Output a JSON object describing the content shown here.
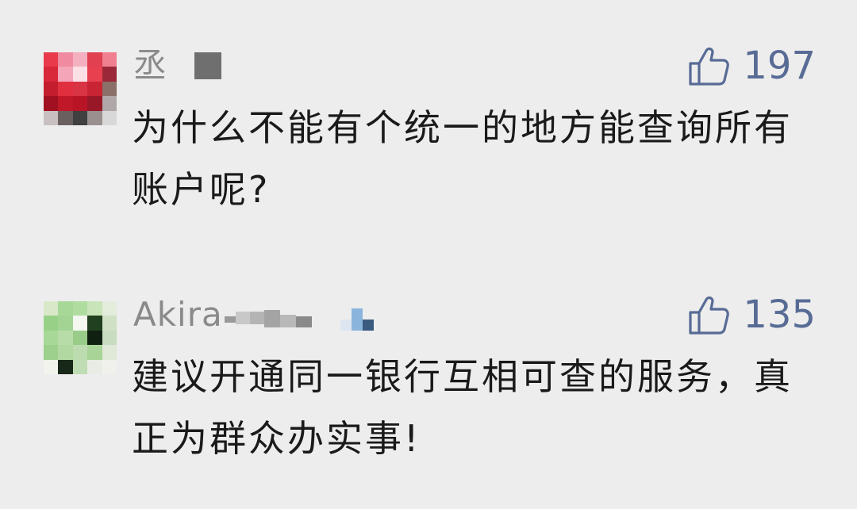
{
  "comments": [
    {
      "username": "丞",
      "likes": "197",
      "text": "为什么不能有个统一的地方能查询所有账户呢?",
      "avatar_colors": [
        [
          "#e83a4a",
          "#f08aa0",
          "#f5b0c0",
          "#e04050",
          "#f08090"
        ],
        [
          "#d8283a",
          "#f4a6b8",
          "#fbe0e6",
          "#e8404e",
          "#9a2838"
        ],
        [
          "#c41e2e",
          "#e03040",
          "#d83444",
          "#c82434",
          "#8a7068"
        ],
        [
          "#a01020",
          "#c01828",
          "#b81426",
          "#981828",
          "#b0a8a8"
        ],
        [
          "#c8c0c0",
          "#6a6060",
          "#404040",
          "#9a9090",
          "#d8d8d8"
        ]
      ]
    },
    {
      "username": "Akira",
      "likes": "135",
      "text": "建议开通同一银行互相可查的服务，真正为群众办实事!",
      "avatar_colors": [
        [
          "#d8e8c8",
          "#a8d898",
          "#b0dca0",
          "#c8e4b8",
          "#e4ecdc"
        ],
        [
          "#98d088",
          "#a4d494",
          "#f4f8f0",
          "#204020",
          "#d0e0c4"
        ],
        [
          "#a8d898",
          "#b8dca8",
          "#98cc88",
          "#102010",
          "#c8dcc0"
        ],
        [
          "#9cd08c",
          "#b0d8a0",
          "#bcdcb0",
          "#a8d498",
          "#e0e8d8"
        ],
        [
          "#f0f4ec",
          "#182818",
          "#c0dcb4",
          "#e8ece4",
          "#f0f0ec"
        ]
      ]
    }
  ],
  "colors": {
    "background": "#ededed",
    "username": "#8a8a8a",
    "likes": "#576b95",
    "text": "#1a1a1a"
  },
  "icons": {
    "like": "thumbs-up-icon"
  }
}
